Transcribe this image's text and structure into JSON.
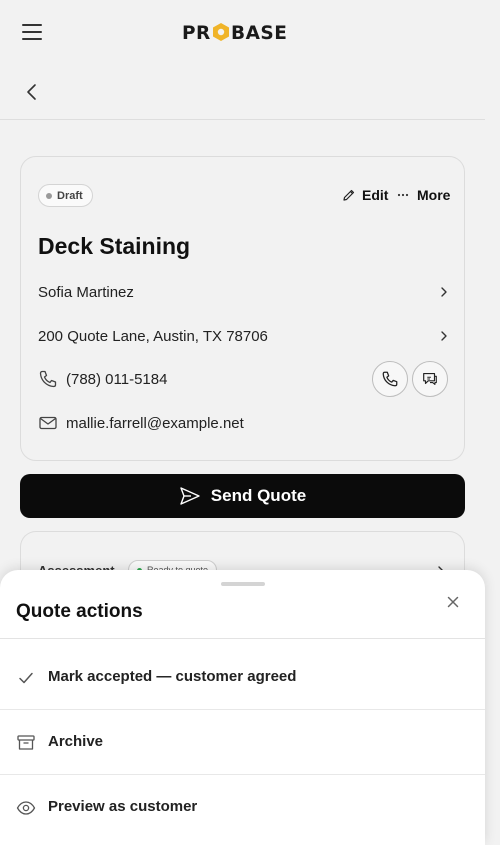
{
  "header": {
    "logo_text": "PROBASE",
    "menu_icon": "hamburger-menu-icon",
    "back_icon": "chevron-left-icon"
  },
  "quote": {
    "status": "Draft",
    "edit_label": "Edit",
    "more_label": "More",
    "title": "Deck Staining",
    "customer_name": "Sofia Martinez",
    "address": "200 Quote Lane, Austin, TX 78706",
    "phone": "(788) 011-5184",
    "email": "mallie.farrell@example.net"
  },
  "send_button_label": "Send Quote",
  "assessment": {
    "label": "Assessment",
    "status": "Ready to quote",
    "status_color": "#2fa84f"
  },
  "sheet": {
    "title": "Quote actions",
    "actions": [
      {
        "label": "Mark accepted — customer agreed",
        "icon": "check-icon"
      },
      {
        "label": "Archive",
        "icon": "archive-box-icon"
      },
      {
        "label": "Preview as customer",
        "icon": "eye-icon"
      }
    ]
  },
  "colors": {
    "logo_accent": "#f0b429",
    "primary_button": "#0b0b0b"
  }
}
